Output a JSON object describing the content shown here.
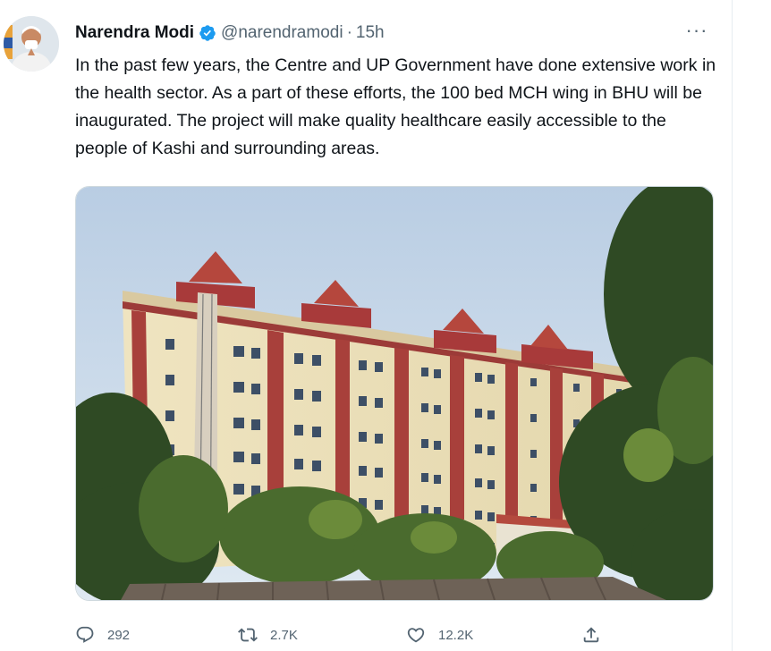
{
  "tweet": {
    "author_name": "Narendra Modi",
    "handle": "@narendramodi",
    "separator": "·",
    "time": "15h",
    "more_label": "···",
    "text": "In the past few years, the Centre and UP Government have done extensive work in the health sector. As a part of these efforts, the 100 bed MCH wing in BHU will be inaugurated. The project will make quality healthcare easily accessible to the people of Kashi and surrounding areas.",
    "icons": {
      "verified": "verified-badge-icon",
      "more": "more-options-icon",
      "reply": "reply-icon",
      "retweet": "retweet-icon",
      "like": "like-icon",
      "share": "share-icon"
    }
  },
  "actions": {
    "reply_count": "292",
    "retweet_count": "2.7K",
    "like_count": "12.2K"
  },
  "colors": {
    "verified": "#1d9bf0",
    "secondary_text": "#536471",
    "primary_text": "#0f1419"
  }
}
